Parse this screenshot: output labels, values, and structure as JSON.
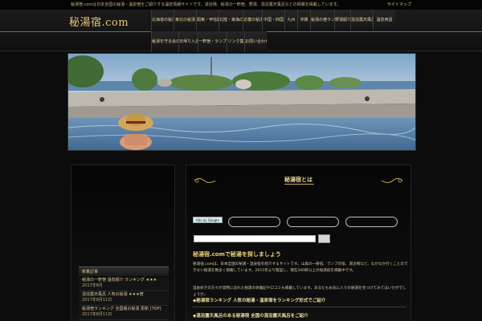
{
  "topline": {
    "tagline": "秘湯宿.comは日本全国の秘湯・温泉宿をご紹介する温泉情報サイトです。湯治場、秘湯の一軒宿、野湯、混浴露天風呂などの情報を掲載しています。",
    "sitemap": "サイトマップ"
  },
  "header": {
    "logo_main": "秘湯宿",
    "logo_dot": ".",
    "logo_tld": "com"
  },
  "nav": {
    "row1": [
      "北海道の秘湯",
      "東北の秘湯",
      "関東・甲信越の秘湯",
      "北陸・東海の秘湯",
      "近畿の秘湯",
      "中国・四国",
      "九州",
      "沖縄",
      "秘湯の宿ランキング",
      "野湯紹介",
      "混浴露天風呂",
      "温泉用語"
    ],
    "row2": [
      "秘湯を守る会の宿",
      "日帰り入浴",
      "一軒宿・ランプの宿",
      "リンク集",
      "お問い合わせ"
    ]
  },
  "sidebar": {
    "head": "新着記事",
    "entries": [
      {
        "title": "秘湯の一軒宿 温泉紹介 ランキング ★★★",
        "date": "2017年8月"
      },
      {
        "title": "混浴露天風呂 人気の秘湯 ★★★宿",
        "date": "2017年8月11日"
      },
      {
        "title": "秘湯宿ランキング 全国版の秘湯 更新 [TOP]",
        "date": "2017年8月11日"
      }
    ]
  },
  "main": {
    "title": "秘湯宿とは",
    "ads_label": "Ads by Google",
    "search_placeholder": "",
    "section_head": "秘湯宿.comで秘湯を探しましょう",
    "para1": "秘湯宿.comは、日本全国の秘湯・温泉宿を紹介するサイトです。山奥の一軒宿、ランプの宿、湯治場など、なかなか行くことのできない秘湯を数多く掲載しています。2015年より開設し、現在200軒以上の秘湯宿を掲載中です。",
    "para2": "温泉好きの方々が実際に訪れた秘湯の体験記や口コミも掲載しています。あなたもお気に入りの秘湯を見つけてみてはいかがでしょうか。",
    "link1": "◆秘湯宿ランキング 人気の秘湯・温泉宿をランキング形式でご紹介",
    "link2": "◆混浴露天風呂のある秘湯宿 全国の混浴露天風呂をご紹介"
  }
}
